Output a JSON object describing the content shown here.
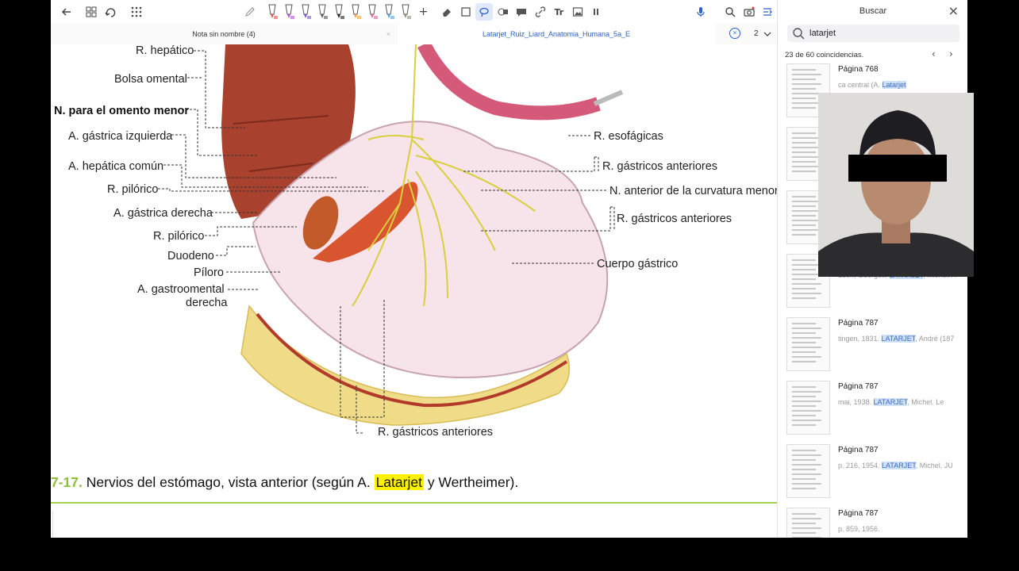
{
  "toolbar": {
    "icons": [
      "back-arrow-icon",
      "grid-icon",
      "rotate-icon",
      "apps-icon",
      "pencil-icon",
      "pen-tool-icon",
      "lasso-icon",
      "eraser-icon",
      "rectangle-icon",
      "comment-icon",
      "link-icon",
      "image-icon",
      "text-icon",
      "pause-icon",
      "microphone-icon",
      "search-icon",
      "camera-icon",
      "sidebar-toggle-icon"
    ],
    "pen_colors": [
      "#e8524a",
      "#b64bd8",
      "#7b58c9",
      "#555555",
      "#222222",
      "#f1a02b",
      "#e35c9e",
      "#4aa3df",
      "#9a8a7a"
    ],
    "text_tool_label": "Tr"
  },
  "tabs": {
    "tab1_label": "Nota sin nombre (4)",
    "tab1_close": "×",
    "tab2_label": "Latarjet_Ruiz_Liard_Anatomia_Humana_5a_E",
    "tab2_close": "×",
    "page_number": "2",
    "page_chevron": "⌄"
  },
  "figure": {
    "labels_left": [
      "R. hepático",
      "Bolsa omental",
      "N. para el omento menor",
      "A. gástrica izquierda",
      "A. hepática común",
      "R. pilórico",
      "A. gástrica derecha",
      "R. pilórico",
      "Duodeno",
      "Píloro",
      "A. gastroomental",
      "derecha"
    ],
    "labels_right": [
      "R. esofágicas",
      "R. gástricos anteriores",
      "N. anterior de la curvatura menor",
      "R. gástricos anteriores",
      "Cuerpo gástrico"
    ],
    "label_bottom": "R. gástricos anteriores"
  },
  "caption": {
    "number": "7-17.",
    "text_before": " Nervios del estómago, vista anterior (según A. ",
    "highlight": "Latarjet",
    "text_after": " y Wertheimer)."
  },
  "sidebar": {
    "title": "Buscar",
    "close": "×",
    "search_value": "latarjet",
    "match_count": "23 de 60 coincidencias.",
    "prev": "‹",
    "next": "›",
    "results": [
      {
        "page": "Página 768",
        "pre": "ca central (A. ",
        "hl": "Latarjet",
        "post": ""
      },
      {
        "page": "",
        "pre": "",
        "hl": "",
        "post": ""
      },
      {
        "page": "",
        "pre": "",
        "hl": "",
        "post": ""
      },
      {
        "page": "",
        "pre": "Léon, Georges; ",
        "hl": "LATARJET",
        "post": ", Michel. A"
      },
      {
        "page": "Página 787",
        "pre": "tingen, 1831. ",
        "hl": "LATARJET",
        "post": ", André (187"
      },
      {
        "page": "Página 787",
        "pre": "mai, 1938. ",
        "hl": "LATARJET",
        "post": ", Michel. Le"
      },
      {
        "page": "Página 787",
        "pre": "p. 216, 1954. ",
        "hl": "LATARJET",
        "post": ", Michel, JU"
      },
      {
        "page": "Página 787",
        "pre": "p. 859, 1956.",
        "hl": "",
        "post": ""
      }
    ]
  }
}
